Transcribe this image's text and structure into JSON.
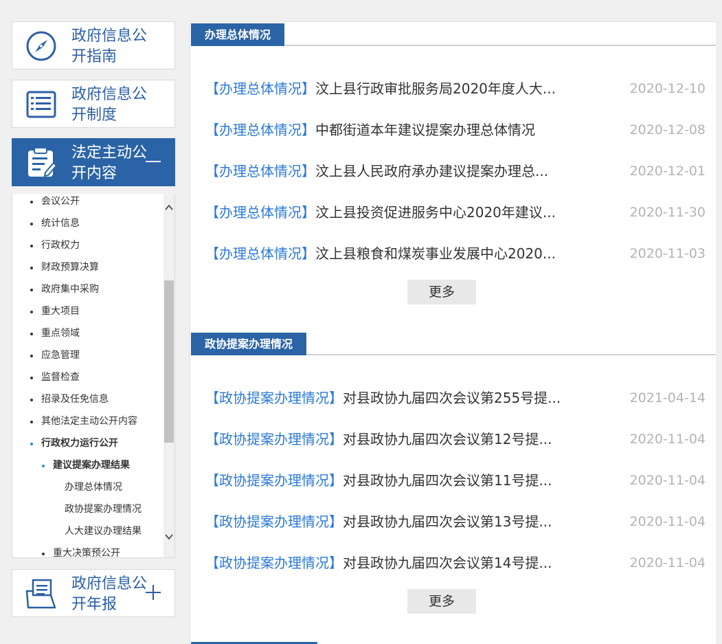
{
  "sidebar": {
    "guide": {
      "label": "政府信息公开指南",
      "icon": "compass-icon"
    },
    "system": {
      "label": "政府信息公开制度",
      "icon": "document-list-icon"
    },
    "content": {
      "label": "法定主动公开内容",
      "icon": "clipboard-edit-icon",
      "toggle": "minus-icon"
    },
    "annual": {
      "label": "政府信息公开年报",
      "icon": "folder-document-icon",
      "toggle": "plus-icon"
    },
    "menu": [
      {
        "label": "会议公开"
      },
      {
        "label": "统计信息"
      },
      {
        "label": "行政权力"
      },
      {
        "label": "财政预算决算"
      },
      {
        "label": "政府集中采购"
      },
      {
        "label": "重大项目"
      },
      {
        "label": "重点领域"
      },
      {
        "label": "应急管理"
      },
      {
        "label": "监督检查"
      },
      {
        "label": "招录及任免信息"
      },
      {
        "label": "其他法定主动公开内容"
      },
      {
        "label": "行政权力运行公开"
      },
      {
        "label": "建议提案办理结果"
      },
      {
        "label": "办理总体情况"
      },
      {
        "label": "政协提案办理情况"
      },
      {
        "label": "人大建议办理结果"
      },
      {
        "label": "重大决策预公开"
      }
    ]
  },
  "sections": [
    {
      "title": "办理总体情况",
      "more": "更多",
      "items": [
        {
          "cat": "【办理总体情况】",
          "title": "汶上县行政审批服务局2020年度人大...",
          "date": "2020-12-10"
        },
        {
          "cat": "【办理总体情况】",
          "title": "中都街道本年建议提案办理总体情况",
          "date": "2020-12-08"
        },
        {
          "cat": "【办理总体情况】",
          "title": "汶上县人民政府承办建议提案办理总...",
          "date": "2020-12-01"
        },
        {
          "cat": "【办理总体情况】",
          "title": "汶上县投资促进服务中心2020年建议...",
          "date": "2020-11-30"
        },
        {
          "cat": "【办理总体情况】",
          "title": "汶上县粮食和煤炭事业发展中心2020...",
          "date": "2020-11-03"
        }
      ]
    },
    {
      "title": "政协提案办理情况",
      "more": "更多",
      "items": [
        {
          "cat": "【政协提案办理情况】",
          "title": "对县政协九届四次会议第255号提...",
          "date": "2021-04-14"
        },
        {
          "cat": "【政协提案办理情况】",
          "title": "对县政协九届四次会议第12号提...",
          "date": "2020-11-04"
        },
        {
          "cat": "【政协提案办理情况】",
          "title": "对县政协九届四次会议第11号提...",
          "date": "2020-11-04"
        },
        {
          "cat": "【政协提案办理情况】",
          "title": "对县政协九届四次会议第13号提...",
          "date": "2020-11-04"
        },
        {
          "cat": "【政协提案办理情况】",
          "title": "对县政协九届四次会议第14号提...",
          "date": "2020-11-04"
        }
      ]
    }
  ],
  "colors": {
    "accent": "#2b64a6",
    "category": "#2b79d6",
    "date": "#b3b3b3"
  }
}
